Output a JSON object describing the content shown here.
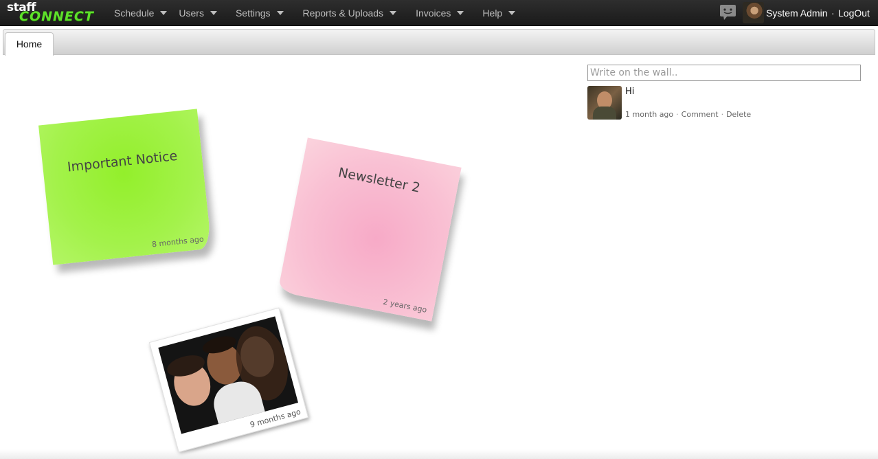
{
  "brand": {
    "line1": "staff",
    "line2": "CONNECT",
    "accent": "#5ee02a"
  },
  "nav": [
    {
      "label": "Schedule"
    },
    {
      "label": "Users"
    },
    {
      "label": "Settings"
    },
    {
      "label": "Reports & Uploads"
    },
    {
      "label": "Invoices"
    },
    {
      "label": "Help"
    }
  ],
  "user": {
    "name": "System Admin",
    "separator": "·",
    "logout": "LogOut"
  },
  "tabs": [
    {
      "label": "Home",
      "active": true
    }
  ],
  "notes": [
    {
      "title": "Important Notice",
      "time": "8 months ago",
      "color": "#9bf03a"
    },
    {
      "title": "Newsletter 2",
      "time": "2 years ago",
      "color": "#f9b8cf"
    }
  ],
  "photo": {
    "time": "9 months ago"
  },
  "wall": {
    "placeholder": "Write on the wall..",
    "posts": [
      {
        "text": "Hi",
        "time": "1 month ago",
        "comment": "Comment",
        "delete": "Delete",
        "separator": "·"
      }
    ]
  },
  "icons": {
    "chat": "chat-bubble-icon",
    "caret": "chevron-down-icon"
  }
}
